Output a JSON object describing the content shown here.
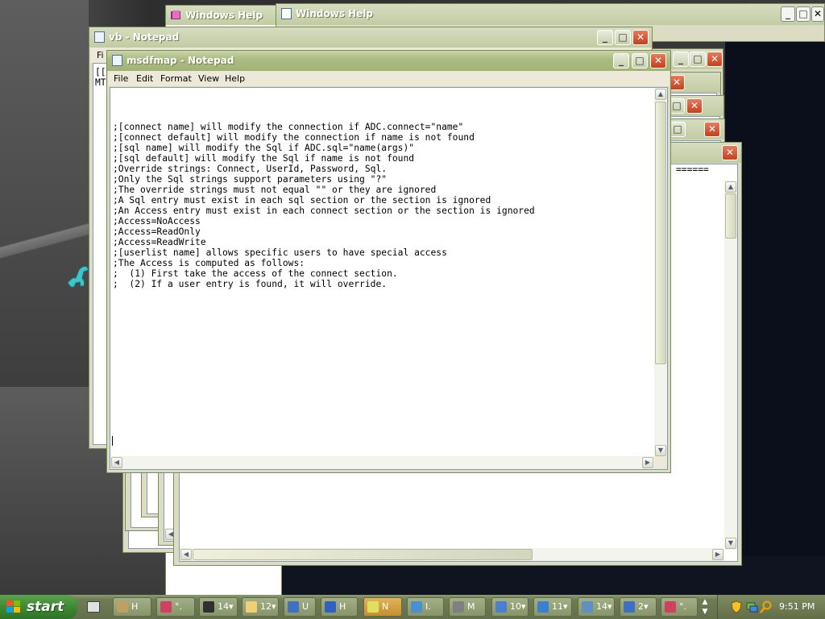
{
  "windows": {
    "help_back": {
      "title": "Windows Help"
    },
    "help_front": {
      "title": "Windows Help"
    },
    "vb": {
      "title": "vb - Notepad",
      "menu_partial": "Fi",
      "text_partial": [
        "[[A",
        "MT"
      ]
    },
    "msdfmap": {
      "title": "msdfmap - Notepad",
      "menu": [
        "File",
        "Edit",
        "Format",
        "View",
        "Help"
      ],
      "lines": [
        ";[connect name] will modify the connection if ADC.connect=\"name\"",
        ";[connect default] will modify the connection if name is not found",
        ";[sql name] will modify the Sql if ADC.sql=\"name(args)\"",
        ";[sql default] will modify the Sql if name is not found",
        ";Override strings: Connect, UserId, Password, Sql.",
        ";Only the Sql strings support parameters using \"?\"",
        ";The override strings must not equal \"\" or they are ignored",
        ";A Sql entry must exist in each sql section or the section is ignored",
        ";An Access entry must exist in each connect section or the section is ignored",
        ";Access=NoAccess",
        ";Access=ReadOnly",
        ";Access=ReadWrite",
        ";[userlist name] allows specific users to have special access",
        ";The Access is computed as follows:",
        ";  (1) First take the access of the connect section.",
        ";  (2) If a user entry is found, it will override."
      ]
    },
    "back_text": "======"
  },
  "taskbar": {
    "start_label": "start",
    "buttons": [
      {
        "label": "H",
        "icon": "hypercam-icon"
      },
      {
        "label": "°.",
        "icon": "paint-group-icon"
      },
      {
        "label": "14▾",
        "icon": "cmd-icon"
      },
      {
        "label": "12▾",
        "icon": "folder-icon"
      },
      {
        "label": "U",
        "icon": "setup-icon"
      },
      {
        "label": "H",
        "icon": "help-icon"
      },
      {
        "label": "N",
        "icon": "notepad-pen-icon"
      },
      {
        "label": "I.",
        "icon": "ie-icon"
      },
      {
        "label": "M",
        "icon": "monitor-icon"
      },
      {
        "label": "10▾",
        "icon": "window-group-icon"
      },
      {
        "label": "11▾",
        "icon": "ie-group-icon"
      },
      {
        "label": "14▾",
        "icon": "notepad-group-icon"
      },
      {
        "label": "2▾",
        "icon": "app-group-icon"
      },
      {
        "label": "°.",
        "icon": "paint-icon"
      }
    ],
    "clock": "9:51 PM"
  },
  "colors": {
    "title_active": "#a1b374",
    "start": "#3e8a34",
    "close": "#c4401c"
  }
}
